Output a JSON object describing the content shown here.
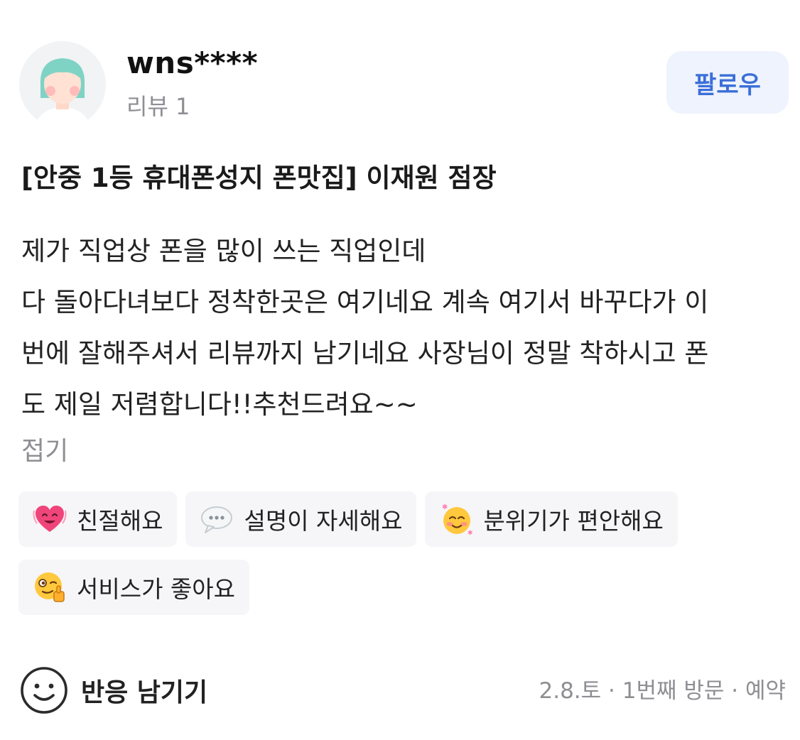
{
  "user": {
    "name": "wns****",
    "review_count": "리뷰 1",
    "avatar_icon": "user-avatar-icon"
  },
  "follow_label": "팔로우",
  "review": {
    "title": "[안중 1등 휴대폰성지 폰맛집] 이재원 점장",
    "lines": [
      "제가 직업상 폰을 많이 쓰는 직업인데",
      "다 돌아다녀보다 정착한곳은 여기네요 계속 여기서 바꾸다가 이",
      "번에 잘해주셔서 리뷰까지 남기네요 사장님이 정말 착하시고 폰",
      "도 제일 저렴합니다!!추천드려요~~"
    ],
    "collapse_label": "접기"
  },
  "tags": [
    {
      "label": "친절해요",
      "icon": "heart-face-icon"
    },
    {
      "label": "설명이 자세해요",
      "icon": "speech-bubble-icon"
    },
    {
      "label": "분위기가 편안해요",
      "icon": "blushing-face-icon"
    },
    {
      "label": "서비스가 좋아요",
      "icon": "wink-thumbs-up-icon"
    }
  ],
  "reaction": {
    "label": "반응 남기기",
    "icon": "smile-outline-icon"
  },
  "visit_meta": "2.8.토 · 1번째 방문 · 예약",
  "colors": {
    "follow_bg": "#eef3fd",
    "follow_text": "#3b6fd8",
    "muted_text": "#8e8e93",
    "tag_bg": "#f6f6f8"
  }
}
